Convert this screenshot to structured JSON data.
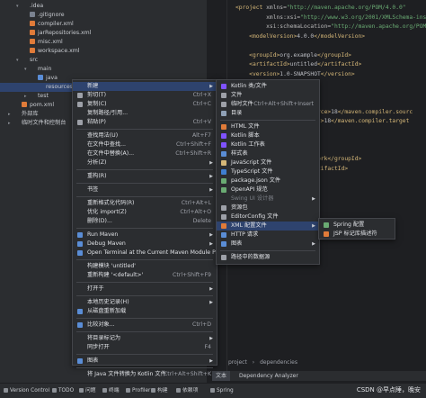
{
  "tree": {
    "items": [
      {
        "label": ".idea",
        "kind": "folder",
        "indent": 2,
        "arrow": "▾"
      },
      {
        "label": ".gitignore",
        "kind": "ign",
        "indent": 3,
        "arrow": ""
      },
      {
        "label": "compiler.xml",
        "kind": "xml",
        "indent": 3,
        "arrow": ""
      },
      {
        "label": "jarRepositories.xml",
        "kind": "xml",
        "indent": 3,
        "arrow": ""
      },
      {
        "label": "misc.xml",
        "kind": "xml",
        "indent": 3,
        "arrow": ""
      },
      {
        "label": "workspace.xml",
        "kind": "xml",
        "indent": 3,
        "arrow": ""
      },
      {
        "label": "src",
        "kind": "folder",
        "indent": 2,
        "arrow": "▾"
      },
      {
        "label": "main",
        "kind": "folder",
        "indent": 3,
        "arrow": "▾"
      },
      {
        "label": "java",
        "kind": "fblue",
        "indent": 4,
        "arrow": ""
      },
      {
        "label": "resources",
        "kind": "folder",
        "indent": 4,
        "arrow": "",
        "selected": true
      },
      {
        "label": "test",
        "kind": "folder",
        "indent": 3,
        "arrow": "▸"
      },
      {
        "label": "pom.xml",
        "kind": "xml",
        "indent": 2,
        "arrow": ""
      },
      {
        "label": "外部库",
        "kind": "folder",
        "indent": 1,
        "arrow": "▸"
      },
      {
        "label": "临时文件和控制台",
        "kind": "folder",
        "indent": 1,
        "arrow": "▸"
      }
    ]
  },
  "editor": {
    "lines": [
      [
        {
          "c": "tg",
          "t": "<project "
        },
        {
          "c": "at",
          "t": "xmlns="
        },
        {
          "c": "sv",
          "t": "\"http://maven.apache.org/POM/4.0.0\""
        }
      ],
      [
        {
          "c": "at",
          "t": "         xmlns:xsi="
        },
        {
          "c": "sv",
          "t": "\"http://www.w3.org/2001/XMLSchema-ins"
        }
      ],
      [
        {
          "c": "at",
          "t": "         xsi:schemaLocation="
        },
        {
          "c": "sv",
          "t": "\"http://maven.apache.org/POM/4."
        }
      ],
      [
        {
          "c": "tg",
          "t": "    <modelVersion>"
        },
        {
          "c": "tx",
          "t": "4.0.0"
        },
        {
          "c": "tg",
          "t": "</modelVersion>"
        }
      ],
      [
        {
          "c": "tx",
          "t": ""
        }
      ],
      [
        {
          "c": "tg",
          "t": "    <groupId>"
        },
        {
          "c": "tx",
          "t": "org.example"
        },
        {
          "c": "tg",
          "t": "</groupId>"
        }
      ],
      [
        {
          "c": "tg",
          "t": "    <artifactId>"
        },
        {
          "c": "tx",
          "t": "untitled"
        },
        {
          "c": "tg",
          "t": "</artifactId>"
        }
      ],
      [
        {
          "c": "tg",
          "t": "    <version>"
        },
        {
          "c": "tx",
          "t": "1.0-SNAPSHOT"
        },
        {
          "c": "tg",
          "t": "</version>"
        }
      ],
      [
        {
          "c": "tx",
          "t": ""
        }
      ],
      [
        {
          "c": "tx",
          "t": ""
        }
      ],
      [
        {
          "c": "tx",
          "t": ""
        }
      ],
      [
        {
          "c": "tg",
          "t": "                    .source>"
        },
        {
          "c": "tx",
          "t": "18"
        },
        {
          "c": "tg",
          "t": "</maven.compiler.sourc"
        }
      ],
      [
        {
          "c": "tg",
          "t": "                    arget>"
        },
        {
          "c": "tx",
          "t": "18"
        },
        {
          "c": "tg",
          "t": "</maven.compiler.target"
        }
      ],
      [
        {
          "c": "tx",
          "t": ""
        }
      ],
      [
        {
          "c": "tx",
          "t": ""
        }
      ],
      [
        {
          "c": "tx",
          "t": ""
        }
      ],
      [
        {
          "c": "tg",
          "t": "                    amework</"
        },
        {
          "c": "tx",
          "t": ""
        },
        {
          "c": "tg",
          "t": "groupId>"
        }
      ],
      [
        {
          "c": "tg",
          "t": "                    </artifactId>"
        }
      ]
    ]
  },
  "breadcrumb": {
    "a": "project",
    "sep": "›",
    "b": "dependencies"
  },
  "bottom_tabs": {
    "text": "文本",
    "analyzer": "Dependency Analyzer"
  },
  "status_items": [
    "Version Control",
    "TODO",
    "问题",
    "终端",
    "Profiler",
    "构建",
    "依赖项",
    "Spring"
  ],
  "watermark": "CSDN @早点睡，晚安",
  "context_menu": {
    "items": [
      {
        "type": "item",
        "label": "新建",
        "sub": true,
        "highlight": true,
        "icon": ""
      },
      {
        "type": "item",
        "label": "剪切(T)",
        "shortcut": "Ctrl+X",
        "icon": "#9da0a8"
      },
      {
        "type": "item",
        "label": "复制(C)",
        "shortcut": "Ctrl+C",
        "icon": "#9da0a8"
      },
      {
        "type": "item",
        "label": "复制路径/引用...",
        "icon": ""
      },
      {
        "type": "item",
        "label": "粘贴(P)",
        "shortcut": "Ctrl+V",
        "icon": "#9da0a8"
      },
      {
        "type": "sep"
      },
      {
        "type": "item",
        "label": "查找用法(U)",
        "shortcut": "Alt+F7",
        "icon": ""
      },
      {
        "type": "item",
        "label": "在文件中查找...",
        "shortcut": "Ctrl+Shift+F",
        "icon": ""
      },
      {
        "type": "item",
        "label": "在文件中替换(A)...",
        "shortcut": "Ctrl+Shift+R",
        "icon": ""
      },
      {
        "type": "item",
        "label": "分析(Z)",
        "sub": true,
        "icon": ""
      },
      {
        "type": "sep"
      },
      {
        "type": "item",
        "label": "重构(R)",
        "sub": true,
        "icon": ""
      },
      {
        "type": "sep"
      },
      {
        "type": "item",
        "label": "书签",
        "sub": true,
        "icon": ""
      },
      {
        "type": "sep"
      },
      {
        "type": "item",
        "label": "重新格式化代码(R)",
        "shortcut": "Ctrl+Alt+L",
        "icon": ""
      },
      {
        "type": "item",
        "label": "优化 import(Z)",
        "shortcut": "Ctrl+Alt+O",
        "icon": ""
      },
      {
        "type": "item",
        "label": "删除(D)...",
        "shortcut": "Delete",
        "icon": ""
      },
      {
        "type": "sep"
      },
      {
        "type": "item",
        "label": "Run Maven",
        "sub": true,
        "icon": "#5a8dd6"
      },
      {
        "type": "item",
        "label": "Debug Maven",
        "sub": true,
        "icon": "#5a8dd6"
      },
      {
        "type": "item",
        "label": "Open Terminal at the Current Maven Module Path",
        "icon": "#5a8dd6"
      },
      {
        "type": "sep"
      },
      {
        "type": "item",
        "label": "构建模块 'untitled'",
        "icon": ""
      },
      {
        "type": "item",
        "label": "重新构建 '<default>'",
        "shortcut": "Ctrl+Shift+F9",
        "icon": ""
      },
      {
        "type": "sep"
      },
      {
        "type": "item",
        "label": "打开于",
        "sub": true,
        "icon": ""
      },
      {
        "type": "sep"
      },
      {
        "type": "item",
        "label": "本地历史记录(H)",
        "sub": true,
        "icon": ""
      },
      {
        "type": "item",
        "label": "从磁盘重新加载",
        "icon": "#5a8dd6"
      },
      {
        "type": "sep"
      },
      {
        "type": "item",
        "label": "比较对象...",
        "shortcut": "Ctrl+D",
        "icon": "#5a8dd6"
      },
      {
        "type": "sep"
      },
      {
        "type": "item",
        "label": "将目录标记为",
        "sub": true,
        "icon": ""
      },
      {
        "type": "item",
        "label": "同步打开",
        "shortcut": "F4",
        "icon": ""
      },
      {
        "type": "sep"
      },
      {
        "type": "item",
        "label": "图表",
        "sub": true,
        "icon": "#5a8dd6"
      },
      {
        "type": "sep"
      },
      {
        "type": "item",
        "label": "将 Java 文件转换为 Kotlin 文件",
        "shortcut": "Ctrl+Alt+Shift+K",
        "icon": ""
      }
    ]
  },
  "new_menu": {
    "items": [
      {
        "type": "item",
        "label": "Kotlin 类/文件",
        "icon": "#7f52ff"
      },
      {
        "type": "item",
        "label": "文件",
        "icon": "#9da0a8"
      },
      {
        "type": "item",
        "label": "临时文件",
        "shortcut": "Ctrl+Alt+Shift+Insert",
        "icon": "#9da0a8"
      },
      {
        "type": "item",
        "label": "目录",
        "icon": "#8fa0b6"
      },
      {
        "type": "sep"
      },
      {
        "type": "item",
        "label": "HTML 文件",
        "icon": "#e07b39"
      },
      {
        "type": "item",
        "label": "Kotlin 脚本",
        "icon": "#7f52ff"
      },
      {
        "type": "item",
        "label": "Kotlin 工作表",
        "icon": "#7f52ff"
      },
      {
        "type": "item",
        "label": "样式表",
        "icon": "#5a8dd6"
      },
      {
        "type": "item",
        "label": "JavaScript 文件",
        "icon": "#d5b778"
      },
      {
        "type": "item",
        "label": "TypeScript 文件",
        "icon": "#3f7fd0"
      },
      {
        "type": "item",
        "label": "package.json 文件",
        "icon": "#6aab73"
      },
      {
        "type": "item",
        "label": "OpenAPI 规范",
        "icon": "#6aab73"
      },
      {
        "type": "item",
        "label": "Swing UI 设计器",
        "sub": true,
        "disabled": true,
        "icon": ""
      },
      {
        "type": "item",
        "label": "资源包",
        "icon": "#9da0a8"
      },
      {
        "type": "item",
        "label": "EditorConfig 文件",
        "icon": "#9da0a8"
      },
      {
        "type": "item",
        "label": "XML 配置文件",
        "sub": true,
        "highlight": true,
        "icon": "#e07b39"
      },
      {
        "type": "item",
        "label": "HTTP 请求",
        "icon": "#5a8dd6"
      },
      {
        "type": "item",
        "label": "图表",
        "sub": true,
        "icon": "#5a8dd6"
      },
      {
        "type": "sep"
      },
      {
        "type": "item",
        "label": "路径中的数据源",
        "icon": "#9da0a8"
      }
    ]
  },
  "xml_menu": {
    "items": [
      {
        "type": "item",
        "label": "Spring 配置",
        "icon": "#6aab73"
      },
      {
        "type": "item",
        "label": "JSP 标记库描述符",
        "icon": "#e07b39"
      }
    ]
  }
}
